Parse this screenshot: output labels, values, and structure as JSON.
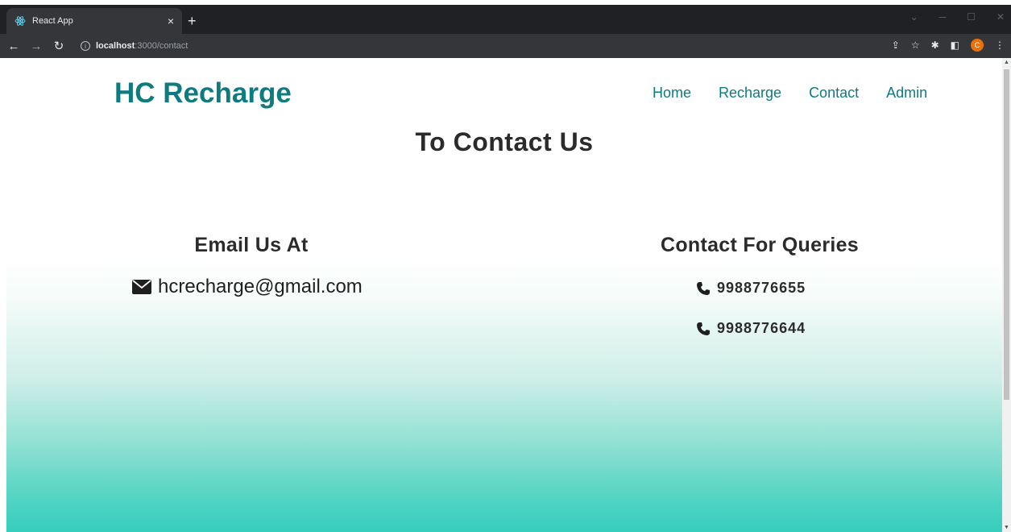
{
  "browser": {
    "tab_title": "React App",
    "tab_close": "×",
    "new_tab": "+",
    "url_host": "localhost",
    "url_rest": ":3000/contact",
    "avatar_letter": "C"
  },
  "site": {
    "brand": "HC Recharge",
    "nav": [
      "Home",
      "Recharge",
      "Contact",
      "Admin"
    ],
    "page_title": "To Contact Us",
    "email_heading": "Email Us At",
    "email": "hcrecharge@gmail.com",
    "queries_heading": "Contact For Queries",
    "phones": [
      "9988776655",
      "9988776644"
    ]
  },
  "colors": {
    "brand": "#0d7b80",
    "gradient_bottom": "#36cdbd"
  },
  "icons": {
    "email": "envelope-icon",
    "phone": "phone-icon",
    "tab": "react-icon"
  }
}
